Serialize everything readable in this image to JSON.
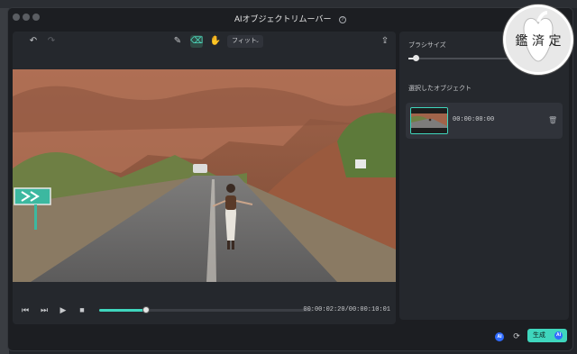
{
  "window": {
    "title": "AIオブジェクトリムーバー",
    "help_glyph": "?"
  },
  "toolbar": {
    "undo_glyph": "↶",
    "redo_glyph": "↷",
    "brush_glyph": "✎",
    "eraser_glyph": "⌫",
    "hand_glyph": "✋",
    "fit_label": "フィット",
    "fit_chevron": "⌄",
    "export_glyph": "⇪"
  },
  "playback": {
    "step_back_glyph": "⏮",
    "step_forward_glyph": "⏭",
    "play_glyph": "▶",
    "stop_glyph": "■",
    "progress": 0.22,
    "timecode": "00:00:02:20/00:00:10:01"
  },
  "panel": {
    "brush_size_label": "ブラシサイズ",
    "brush_size_level": 0.05,
    "selected_objects_label": "選択したオブジェクト",
    "objects": [
      {
        "time": "00:00:00:00",
        "delete_glyph": "🗑"
      }
    ]
  },
  "footer": {
    "ai_badge": "AI",
    "refresh_glyph": "⟳",
    "generate_label": "生成",
    "generate_badge": "AI"
  },
  "watermark_text": "鑑済定",
  "colors": {
    "accent": "#3fd6bd",
    "ai_blue": "#2f6bff"
  }
}
